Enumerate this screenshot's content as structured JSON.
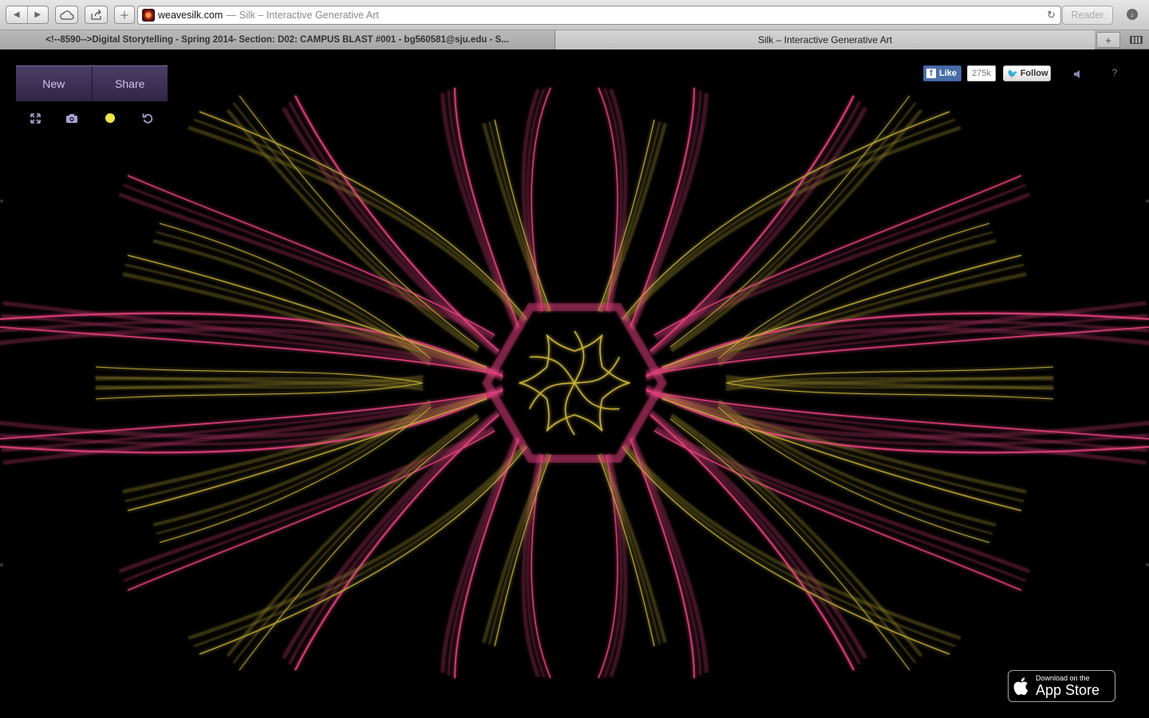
{
  "browser": {
    "url_domain": "weavesilk.com",
    "url_separator": "—",
    "url_title": "Silk – Interactive Generative Art",
    "reader_label": "Reader",
    "tabs": [
      {
        "label": "<!--8590-->Digital Storytelling - Spring 2014- Section: D02: CAMPUS BLAST #001 - bg560581@sju.edu - S..."
      },
      {
        "label": "Silk – Interactive Generative Art"
      }
    ]
  },
  "app": {
    "menu": {
      "new_label": "New",
      "share_label": "Share"
    },
    "tools": [
      "fullscreen-icon",
      "camera-icon",
      "color-dot-icon",
      "undo-icon"
    ],
    "active_color": "#f2e34a",
    "social": {
      "like_label": "Like",
      "like_count": "275k",
      "follow_label": "Follow"
    },
    "help_label": "?",
    "appstore": {
      "small_text": "Download on the",
      "big_text": "App Store"
    },
    "art_colors": {
      "primary": "#e0407a",
      "secondary": "#c9b23a",
      "background": "#000000"
    }
  }
}
